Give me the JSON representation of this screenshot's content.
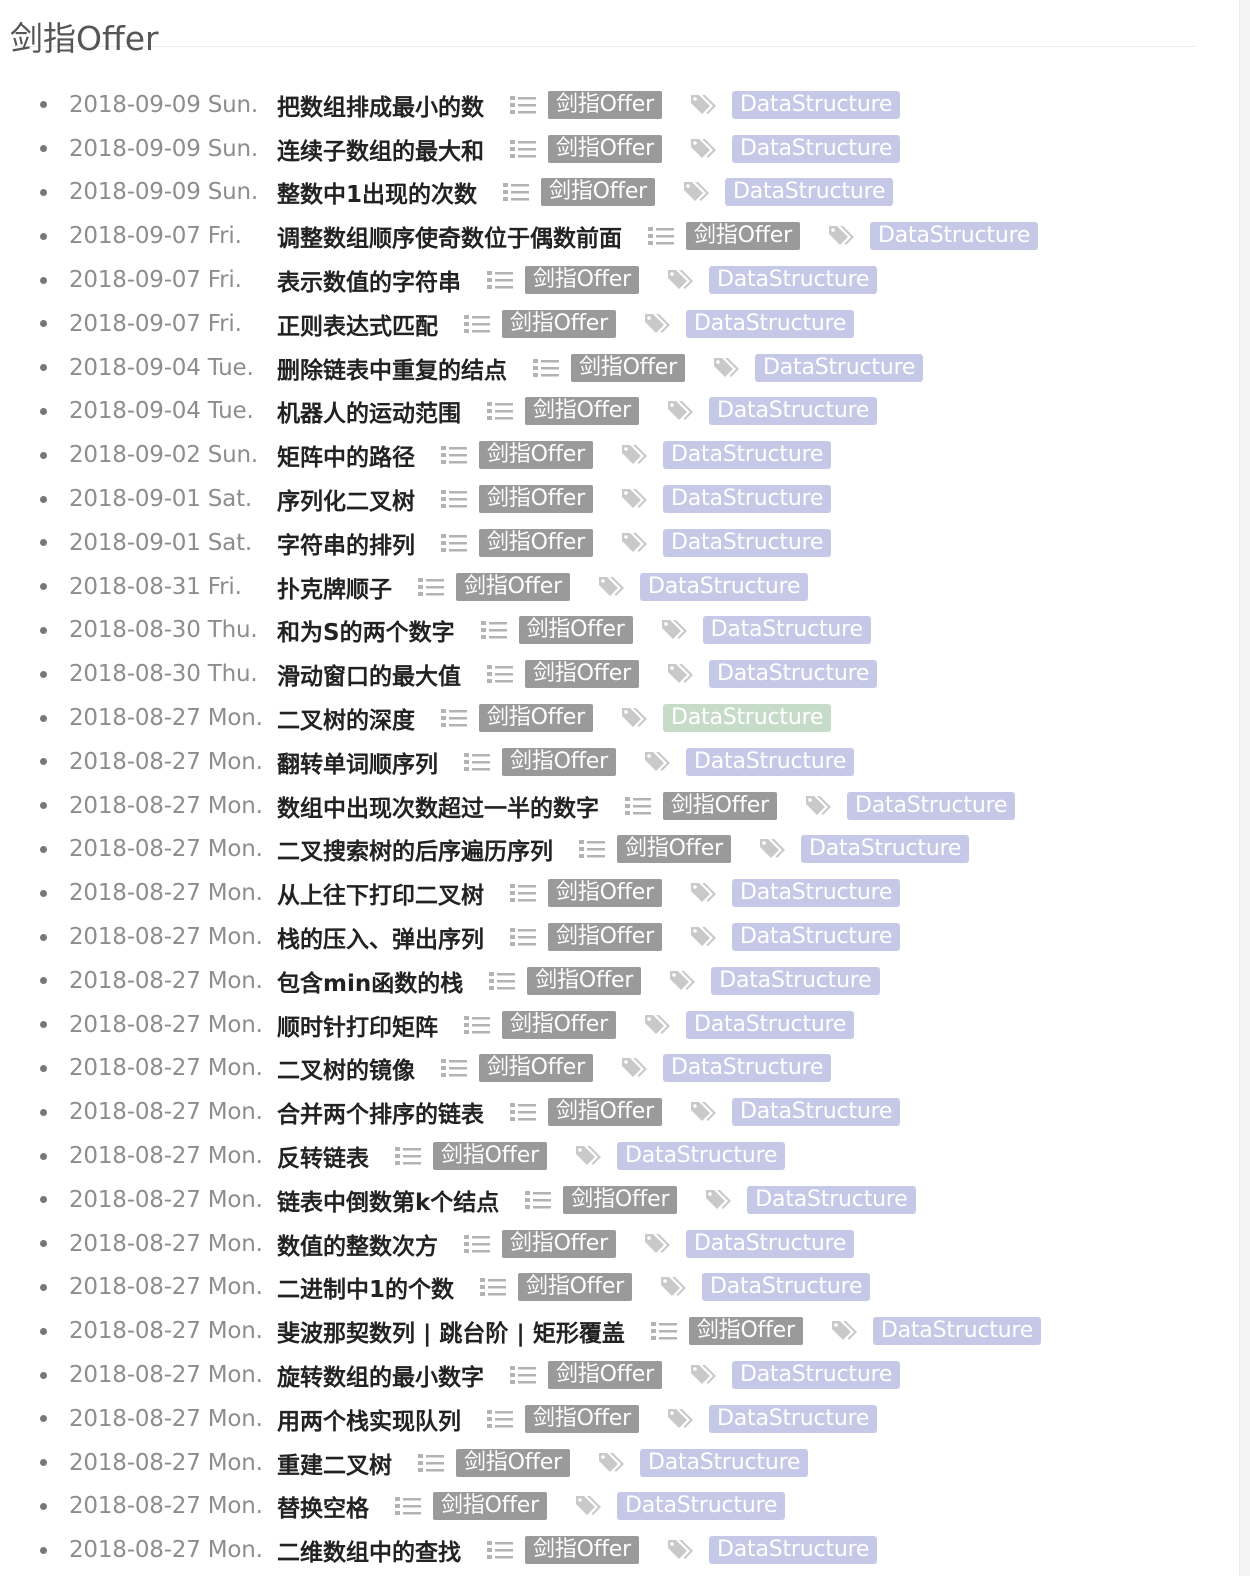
{
  "page": {
    "title": "剑指Offer"
  },
  "icons": {
    "category": "list-icon",
    "tag": "tag-icon"
  },
  "colors": {
    "category_badge": "#9a9a9a",
    "tag_badge": "#c5c8e6",
    "tag_badge_hover": "#c7dcc8",
    "icon": "#b3b3b3"
  },
  "posts": [
    {
      "date": "2018-09-09 Sun.",
      "title": "把数组排成最小的数",
      "category": "剑指Offer",
      "tag": "DataStructure"
    },
    {
      "date": "2018-09-09 Sun.",
      "title": "连续子数组的最大和",
      "category": "剑指Offer",
      "tag": "DataStructure"
    },
    {
      "date": "2018-09-09 Sun.",
      "title": "整数中1出现的次数",
      "category": "剑指Offer",
      "tag": "DataStructure"
    },
    {
      "date": "2018-09-07 Fri.",
      "title": "调整数组顺序使奇数位于偶数前面",
      "category": "剑指Offer",
      "tag": "DataStructure"
    },
    {
      "date": "2018-09-07 Fri.",
      "title": "表示数值的字符串",
      "category": "剑指Offer",
      "tag": "DataStructure"
    },
    {
      "date": "2018-09-07 Fri.",
      "title": "正则表达式匹配",
      "category": "剑指Offer",
      "tag": "DataStructure"
    },
    {
      "date": "2018-09-04 Tue.",
      "title": "删除链表中重复的结点",
      "category": "剑指Offer",
      "tag": "DataStructure"
    },
    {
      "date": "2018-09-04 Tue.",
      "title": "机器人的运动范围",
      "category": "剑指Offer",
      "tag": "DataStructure"
    },
    {
      "date": "2018-09-02 Sun.",
      "title": "矩阵中的路径",
      "category": "剑指Offer",
      "tag": "DataStructure"
    },
    {
      "date": "2018-09-01 Sat.",
      "title": "序列化二叉树",
      "category": "剑指Offer",
      "tag": "DataStructure"
    },
    {
      "date": "2018-09-01 Sat.",
      "title": "字符串的排列",
      "category": "剑指Offer",
      "tag": "DataStructure"
    },
    {
      "date": "2018-08-31 Fri.",
      "title": "扑克牌顺子",
      "category": "剑指Offer",
      "tag": "DataStructure"
    },
    {
      "date": "2018-08-30 Thu.",
      "title": "和为S的两个数字",
      "category": "剑指Offer",
      "tag": "DataStructure"
    },
    {
      "date": "2018-08-30 Thu.",
      "title": "滑动窗口的最大值",
      "category": "剑指Offer",
      "tag": "DataStructure"
    },
    {
      "date": "2018-08-27 Mon.",
      "title": "二叉树的深度",
      "category": "剑指Offer",
      "tag": "DataStructure",
      "hover": true
    },
    {
      "date": "2018-08-27 Mon.",
      "title": "翻转单词顺序列",
      "category": "剑指Offer",
      "tag": "DataStructure"
    },
    {
      "date": "2018-08-27 Mon.",
      "title": "数组中出现次数超过一半的数字",
      "category": "剑指Offer",
      "tag": "DataStructure"
    },
    {
      "date": "2018-08-27 Mon.",
      "title": "二叉搜索树的后序遍历序列",
      "category": "剑指Offer",
      "tag": "DataStructure"
    },
    {
      "date": "2018-08-27 Mon.",
      "title": "从上往下打印二叉树",
      "category": "剑指Offer",
      "tag": "DataStructure"
    },
    {
      "date": "2018-08-27 Mon.",
      "title": "栈的压入、弹出序列",
      "category": "剑指Offer",
      "tag": "DataStructure"
    },
    {
      "date": "2018-08-27 Mon.",
      "title": "包含min函数的栈",
      "category": "剑指Offer",
      "tag": "DataStructure"
    },
    {
      "date": "2018-08-27 Mon.",
      "title": "顺时针打印矩阵",
      "category": "剑指Offer",
      "tag": "DataStructure"
    },
    {
      "date": "2018-08-27 Mon.",
      "title": "二叉树的镜像",
      "category": "剑指Offer",
      "tag": "DataStructure"
    },
    {
      "date": "2018-08-27 Mon.",
      "title": "合并两个排序的链表",
      "category": "剑指Offer",
      "tag": "DataStructure"
    },
    {
      "date": "2018-08-27 Mon.",
      "title": "反转链表",
      "category": "剑指Offer",
      "tag": "DataStructure"
    },
    {
      "date": "2018-08-27 Mon.",
      "title": "链表中倒数第k个结点",
      "category": "剑指Offer",
      "tag": "DataStructure"
    },
    {
      "date": "2018-08-27 Mon.",
      "title": "数值的整数次方",
      "category": "剑指Offer",
      "tag": "DataStructure"
    },
    {
      "date": "2018-08-27 Mon.",
      "title": "二进制中1的个数",
      "category": "剑指Offer",
      "tag": "DataStructure"
    },
    {
      "date": "2018-08-27 Mon.",
      "title": "斐波那契数列 | 跳台阶 | 矩形覆盖",
      "category": "剑指Offer",
      "tag": "DataStructure"
    },
    {
      "date": "2018-08-27 Mon.",
      "title": "旋转数组的最小数字",
      "category": "剑指Offer",
      "tag": "DataStructure"
    },
    {
      "date": "2018-08-27 Mon.",
      "title": "用两个栈实现队列",
      "category": "剑指Offer",
      "tag": "DataStructure"
    },
    {
      "date": "2018-08-27 Mon.",
      "title": "重建二叉树",
      "category": "剑指Offer",
      "tag": "DataStructure"
    },
    {
      "date": "2018-08-27 Mon.",
      "title": "替换空格",
      "category": "剑指Offer",
      "tag": "DataStructure"
    },
    {
      "date": "2018-08-27 Mon.",
      "title": "二维数组中的查找",
      "category": "剑指Offer",
      "tag": "DataStructure"
    }
  ]
}
